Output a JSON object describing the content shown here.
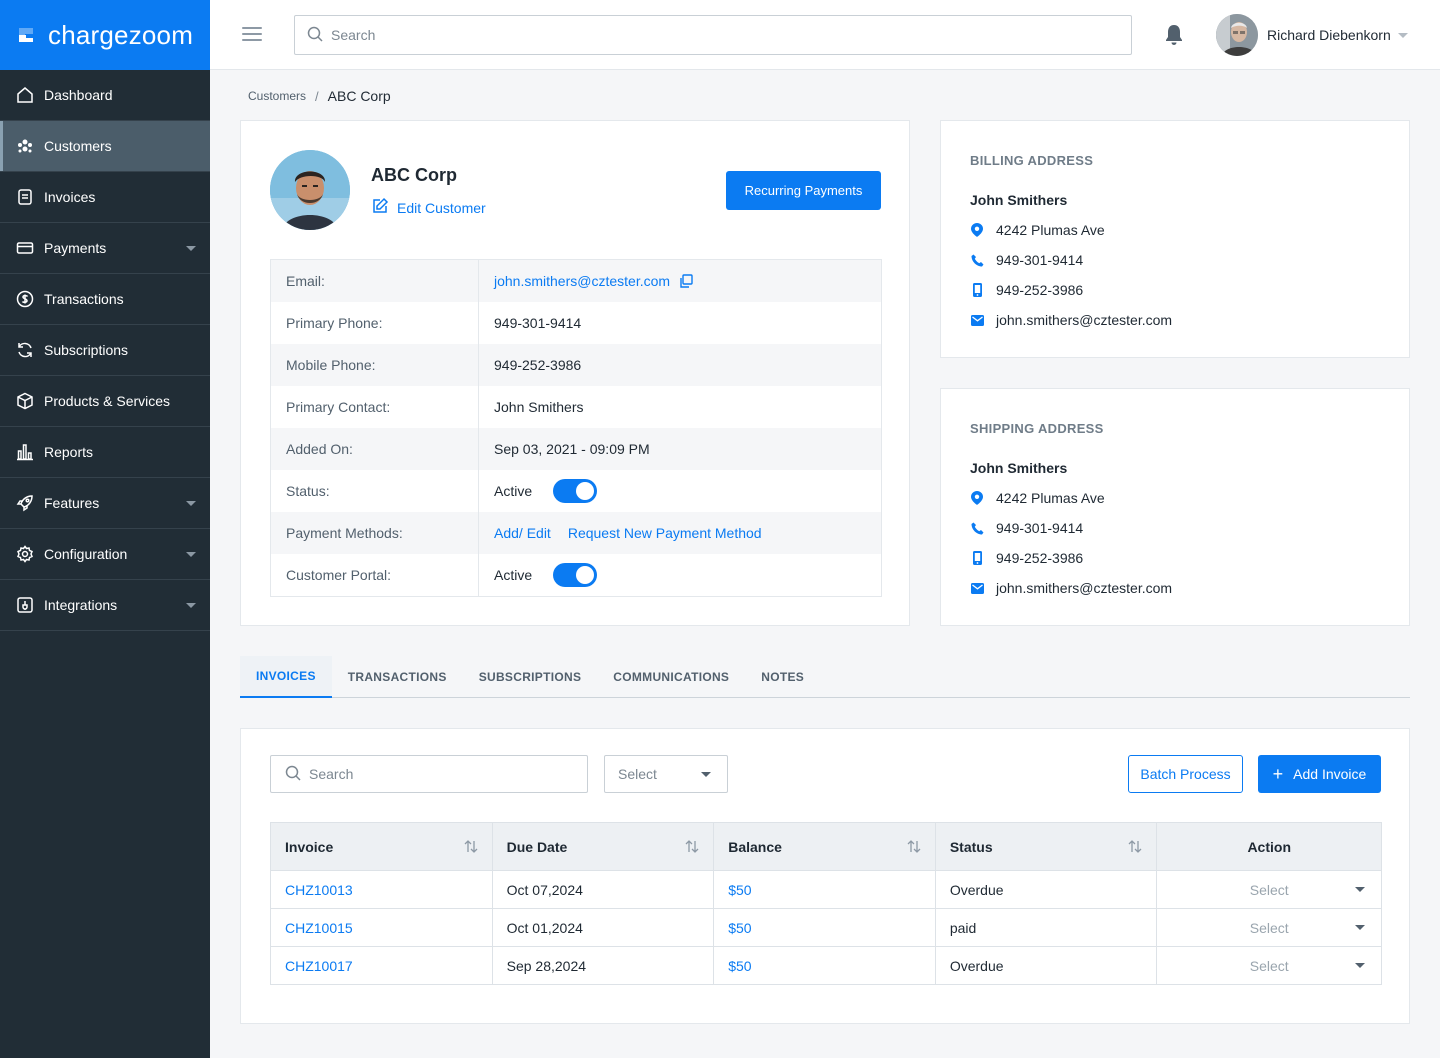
{
  "brand": {
    "name": "chargezoom"
  },
  "header": {
    "search_placeholder": "Search",
    "user_name": "Richard Diebenkorn"
  },
  "sidebar": {
    "items": [
      {
        "label": "Dashboard",
        "icon": "home-icon"
      },
      {
        "label": "Customers",
        "icon": "users-icon",
        "active": true
      },
      {
        "label": "Invoices",
        "icon": "invoice-icon"
      },
      {
        "label": "Payments",
        "icon": "card-icon",
        "has_submenu": true
      },
      {
        "label": "Transactions",
        "icon": "dollar-icon"
      },
      {
        "label": "Subscriptions",
        "icon": "refresh-icon"
      },
      {
        "label": "Products & Services",
        "icon": "box-icon"
      },
      {
        "label": "Reports",
        "icon": "chart-icon"
      },
      {
        "label": "Features",
        "icon": "rocket-icon",
        "has_submenu": true
      },
      {
        "label": "Configuration",
        "icon": "gear-icon",
        "has_submenu": true
      },
      {
        "label": "Integrations",
        "icon": "plug-icon",
        "has_submenu": true
      }
    ]
  },
  "breadcrumb": {
    "parent": "Customers",
    "separator": "/",
    "current": "ABC Corp"
  },
  "profile": {
    "company": "ABC Corp",
    "edit_label": "Edit Customer",
    "recurring_label": "Recurring Payments",
    "rows": {
      "email": {
        "label": "Email:",
        "value": "john.smithers@cztester.com"
      },
      "primary_phone": {
        "label": "Primary Phone:",
        "value": "949-301-9414"
      },
      "mobile_phone": {
        "label": "Mobile Phone:",
        "value": "949-252-3986"
      },
      "primary_contact": {
        "label": "Primary Contact:",
        "value": "John Smithers"
      },
      "added_on": {
        "label": "Added On:",
        "value": "Sep 03, 2021 - 09:09 PM"
      },
      "status": {
        "label": "Status:",
        "value": "Active",
        "enabled": true
      },
      "payment_methods": {
        "label": "Payment Methods:",
        "add_edit": "Add/ Edit",
        "request": "Request New Payment Method"
      },
      "customer_portal": {
        "label": "Customer Portal:",
        "value": "Active",
        "enabled": true
      }
    }
  },
  "billing": {
    "title": "BILLING ADDRESS",
    "name": "John Smithers",
    "address": "4242 Plumas Ave",
    "phone": "949-301-9414",
    "mobile": "949-252-3986",
    "email": "john.smithers@cztester.com"
  },
  "shipping": {
    "title": "SHIPPING ADDRESS",
    "name": "John Smithers",
    "address": "4242 Plumas Ave",
    "phone": "949-301-9414",
    "mobile": "949-252-3986",
    "email": "john.smithers@cztester.com"
  },
  "tabs": [
    {
      "label": "INVOICES",
      "active": true
    },
    {
      "label": "TRANSACTIONS"
    },
    {
      "label": "SUBSCRIPTIONS"
    },
    {
      "label": "COMMUNICATIONS"
    },
    {
      "label": "NOTES"
    }
  ],
  "invoices": {
    "search_placeholder": "Search",
    "filter_value": "Select",
    "batch_label": "Batch Process",
    "add_label": "Add Invoice",
    "columns": [
      "Invoice",
      "Due Date",
      "Balance",
      "Status",
      "Action"
    ],
    "rows": [
      {
        "invoice": "CHZ10013",
        "due": "Oct 07,2024",
        "balance": "$50",
        "status": "Overdue",
        "action": "Select"
      },
      {
        "invoice": "CHZ10015",
        "due": "Oct 01,2024",
        "balance": "$50",
        "status": "paid",
        "action": "Select"
      },
      {
        "invoice": "CHZ10017",
        "due": "Sep 28,2024",
        "balance": "$50",
        "status": "Overdue",
        "action": "Select"
      }
    ]
  },
  "colors": {
    "brand": "#0b7bf2",
    "sidebar": "#212d36",
    "sidebar_active": "#4b5d6a"
  }
}
